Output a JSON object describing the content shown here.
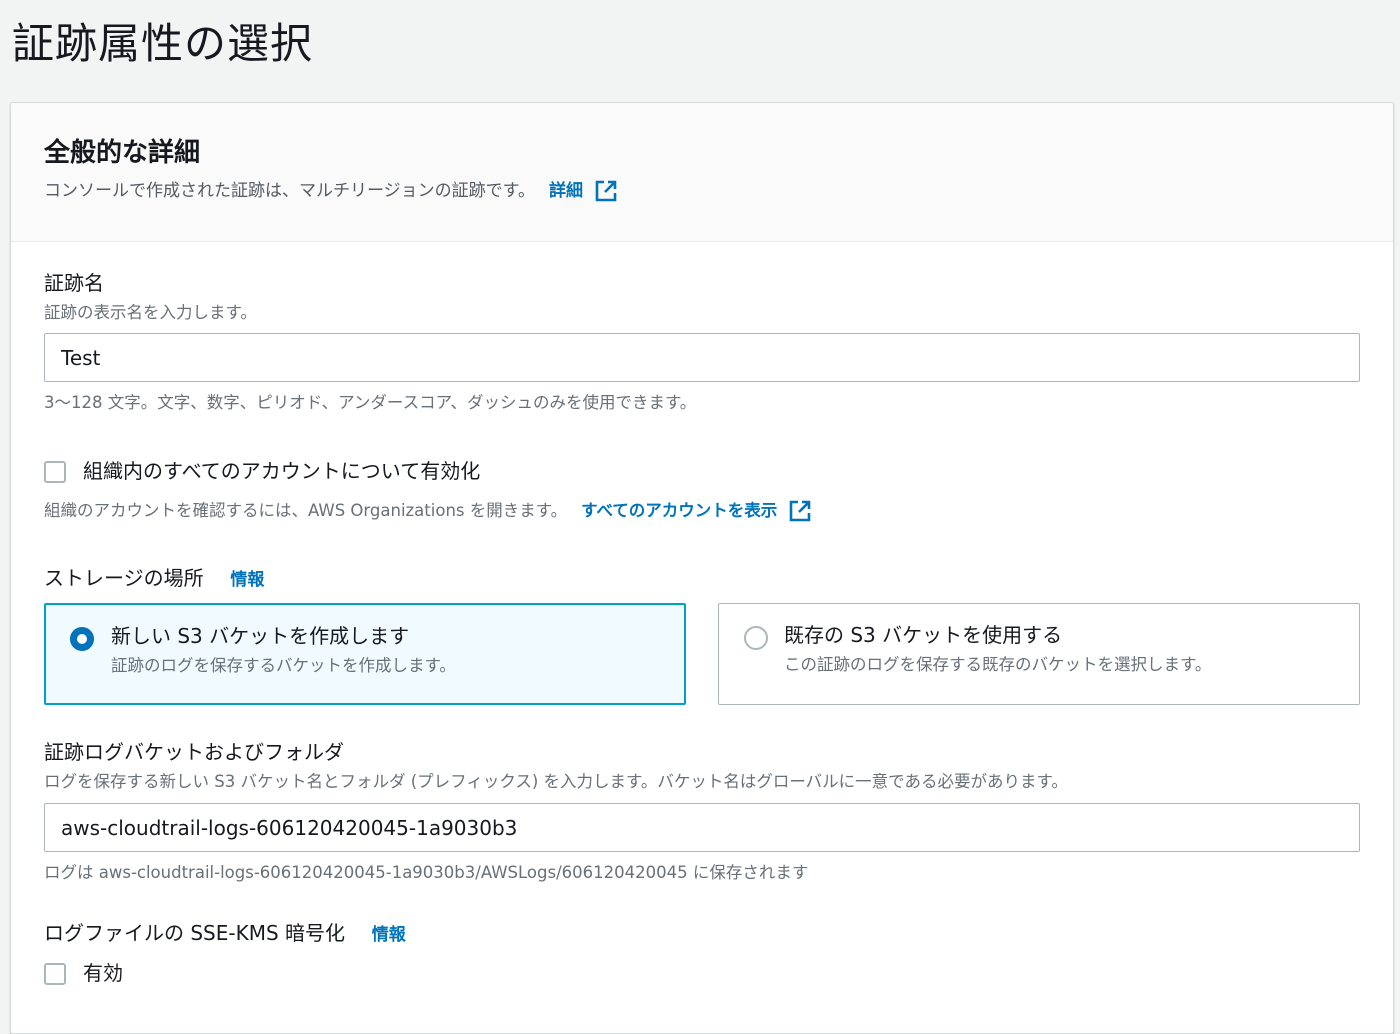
{
  "page": {
    "title": "証跡属性の選択"
  },
  "general": {
    "title": "全般的な詳細",
    "description": "コンソールで作成された証跡は、マルチリージョンの証跡です。",
    "details_link": "詳細"
  },
  "trail_name": {
    "label": "証跡名",
    "description": "証跡の表示名を入力します。",
    "value": "Test",
    "constraint": "3～128 文字。文字、数字、ピリオド、アンダースコア、ダッシュのみを使用できます。"
  },
  "organization": {
    "checkbox_label": "組織内のすべてのアカウントについて有効化",
    "checked": false,
    "description": "組織のアカウントを確認するには、AWS Organizations を開きます。",
    "link": "すべてのアカウントを表示"
  },
  "storage": {
    "label": "ストレージの場所",
    "info_link": "情報",
    "options": [
      {
        "title": "新しい S3 バケットを作成します",
        "description": "証跡のログを保存するバケットを作成します。",
        "selected": true
      },
      {
        "title": "既存の S3 バケットを使用する",
        "description": "この証跡のログを保存する既存のバケットを選択します。",
        "selected": false
      }
    ]
  },
  "bucket": {
    "label": "証跡ログバケットおよびフォルダ",
    "description": "ログを保存する新しい S3 バケット名とフォルダ (プレフィックス) を入力します。バケット名はグローバルに一意である必要があります。",
    "value": "aws-cloudtrail-logs-606120420045-1a9030b3",
    "hint": "ログは aws-cloudtrail-logs-606120420045-1a9030b3/AWSLogs/606120420045 に保存されます"
  },
  "encryption": {
    "label": "ログファイルの SSE-KMS 暗号化",
    "info_link": "情報",
    "checkbox_label": "有効",
    "checked": false
  },
  "colors": {
    "link": "#0073bb",
    "selected_border": "#00a1c9",
    "selected_bg": "#f1faff"
  }
}
